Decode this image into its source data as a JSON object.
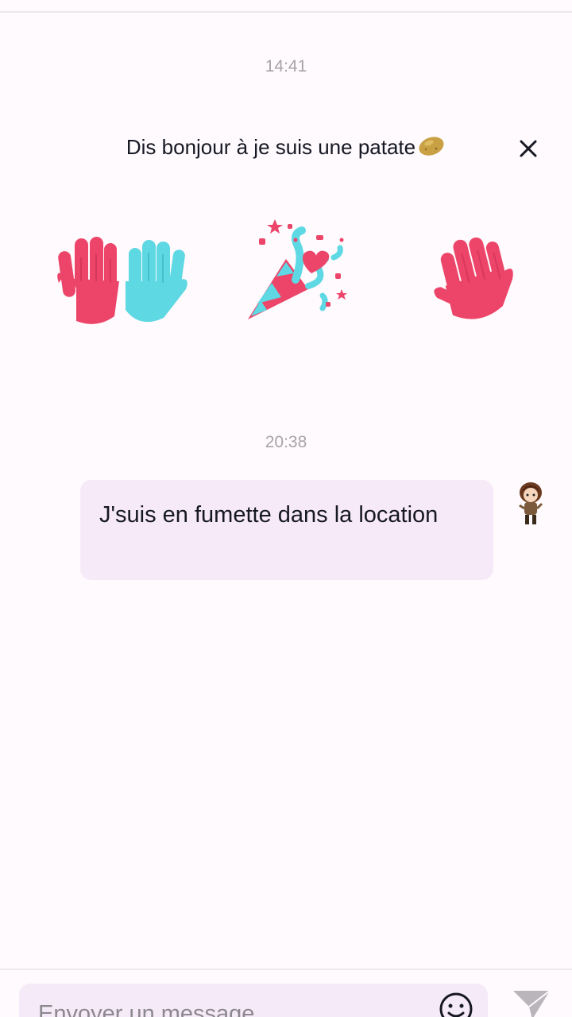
{
  "thread": {
    "timestamp_1": "14:41",
    "greeting": "Dis bonjour à je suis une patate",
    "timestamp_2": "20:38",
    "message_text": "J'suis en fumette dans la location"
  },
  "stickers": [
    "high-five-hands-sticker",
    "party-popper-sticker",
    "waving-hand-sticker"
  ],
  "composer": {
    "placeholder": "Envoyer un message"
  },
  "colors": {
    "background": "#fefafd",
    "bubble": "#f7eaf8",
    "hand_pink": "#ec4569",
    "hand_cyan": "#5ed8e3",
    "timestamp": "#a7a3a8"
  }
}
